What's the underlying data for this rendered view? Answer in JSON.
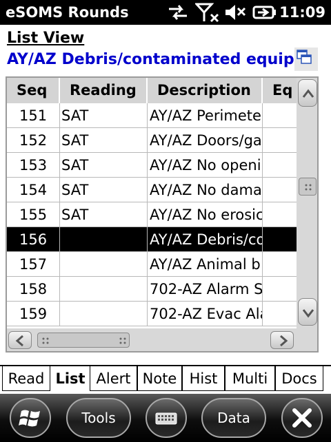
{
  "statusbar": {
    "app_title": "eSOMS Rounds",
    "clock": "11:09",
    "icons": [
      "data-sync-icon",
      "signal-off-icon",
      "volume-muted-icon",
      "battery-charging-icon"
    ]
  },
  "header": {
    "view_title": "List View",
    "round_title": "AY/AZ Debris/contaminated equip"
  },
  "grid": {
    "columns": [
      "Seq",
      "Reading",
      "Description",
      "Eq"
    ],
    "rows": [
      {
        "seq": "151",
        "reading": "SAT",
        "description": "AY/AZ Perimete",
        "eq": ""
      },
      {
        "seq": "152",
        "reading": "SAT",
        "description": "AY/AZ Doors/ga",
        "eq": ""
      },
      {
        "seq": "153",
        "reading": "SAT",
        "description": "AY/AZ No openi",
        "eq": ""
      },
      {
        "seq": "154",
        "reading": "SAT",
        "description": "AY/AZ No dama",
        "eq": ""
      },
      {
        "seq": "155",
        "reading": "SAT",
        "description": "AY/AZ No erosic",
        "eq": ""
      },
      {
        "seq": "156",
        "reading": "",
        "description": "AY/AZ Debris/co",
        "eq": "",
        "selected": true
      },
      {
        "seq": "157",
        "reading": "",
        "description": "AY/AZ Animal b",
        "eq": ""
      },
      {
        "seq": "158",
        "reading": "",
        "description": "702-AZ Alarm S",
        "eq": ""
      },
      {
        "seq": "159",
        "reading": "",
        "description": "702-AZ Evac Ala",
        "eq": ""
      }
    ]
  },
  "tabs": [
    {
      "label": "Read",
      "active": false
    },
    {
      "label": "List",
      "active": true
    },
    {
      "label": "Alert",
      "active": false
    },
    {
      "label": "Note",
      "active": false
    },
    {
      "label": "Hist",
      "active": false
    },
    {
      "label": "Multi",
      "active": false
    },
    {
      "label": "Docs",
      "active": false
    }
  ],
  "softkeys": {
    "start_icon": "windows-start-icon",
    "tools_label": "Tools",
    "keyboard_icon": "keyboard-icon",
    "data_label": "Data",
    "close_icon": "close-icon"
  }
}
